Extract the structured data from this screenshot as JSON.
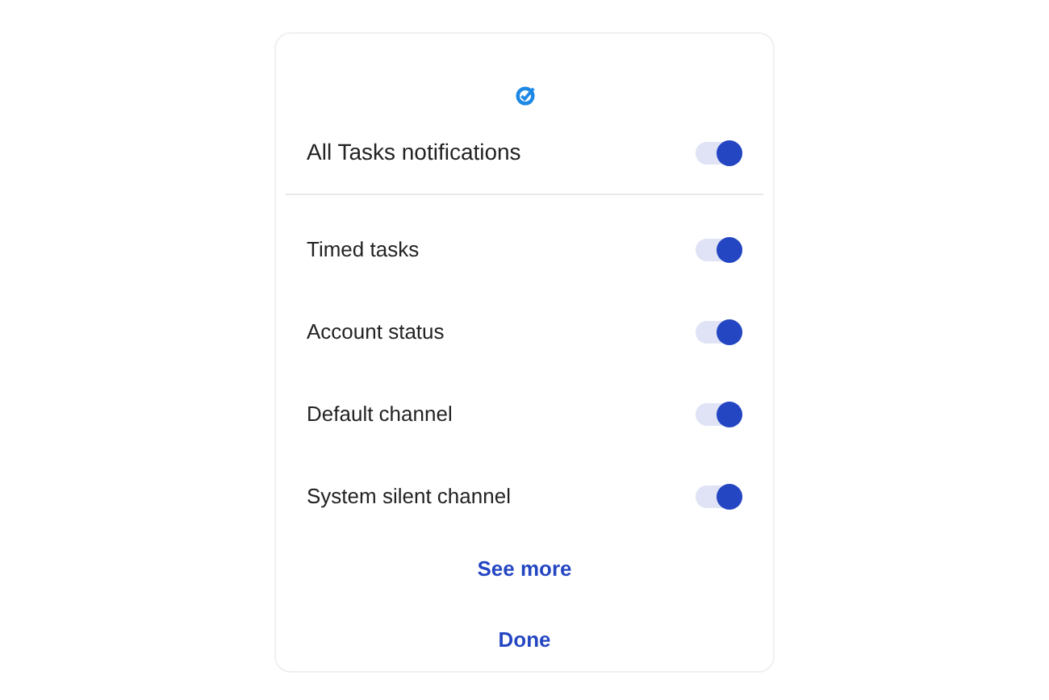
{
  "master": {
    "label": "All Tasks notifications",
    "on": true
  },
  "channels": [
    {
      "label": "Timed tasks",
      "on": true
    },
    {
      "label": "Account status",
      "on": true
    },
    {
      "label": "Default channel",
      "on": true
    },
    {
      "label": "System silent channel",
      "on": true
    }
  ],
  "buttons": [
    "See more",
    "Done"
  ]
}
